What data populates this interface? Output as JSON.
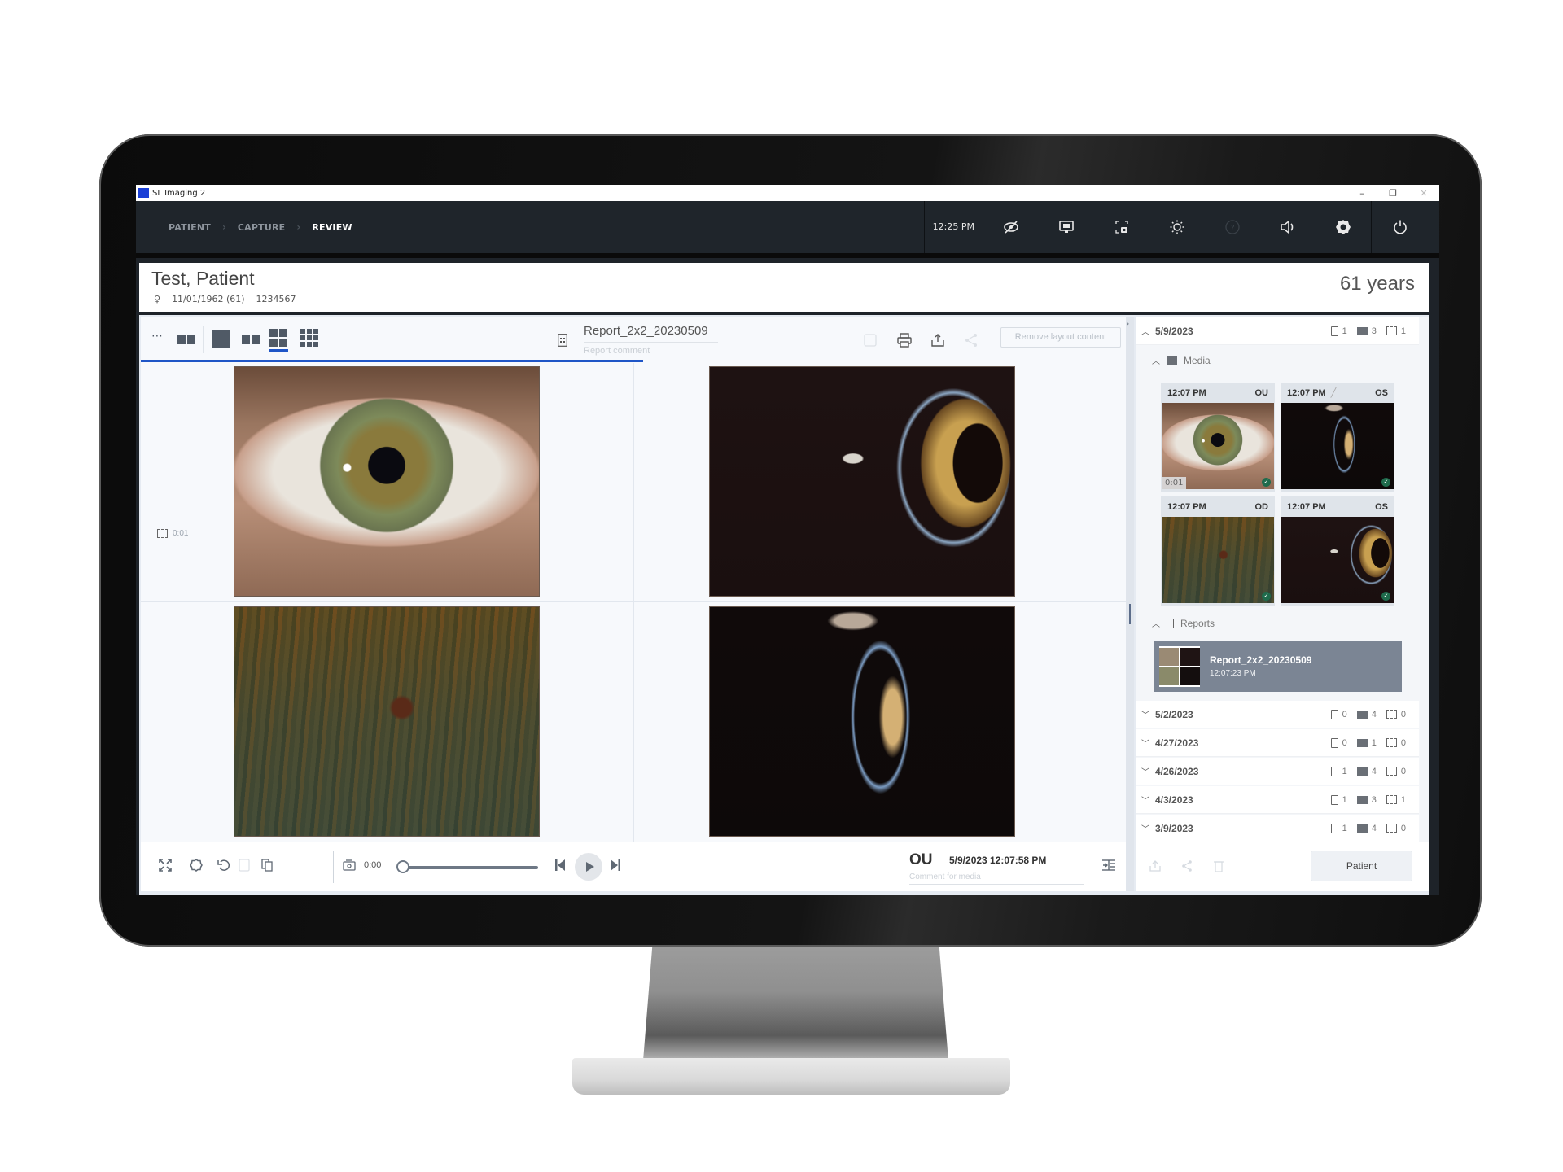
{
  "window": {
    "title": "SL Imaging 2",
    "minimize_label": "–",
    "maximize_label": "❐",
    "close_label": "✕"
  },
  "nav": {
    "breadcrumbs": [
      {
        "label": "PATIENT",
        "active": false
      },
      {
        "label": "CAPTURE",
        "active": false
      },
      {
        "label": "REVIEW",
        "active": true
      }
    ],
    "separator": "›",
    "time": "12:25 PM",
    "icons": [
      "eye-hidden-icon",
      "monitor-camera-icon",
      "screenshot-camera-icon",
      "brightness-icon",
      "help-icon",
      "volume-icon",
      "settings-gear-icon",
      "power-icon"
    ]
  },
  "patient": {
    "name": "Test, Patient",
    "sex_icon": "♀",
    "dob": "11/01/1962 (61)",
    "id": "1234567",
    "age": "61 years"
  },
  "toolbar": {
    "more_label": "⋯",
    "layouts": [
      "compare",
      "1x1",
      "1x2",
      "2x2",
      "3x3"
    ],
    "selected_layout": "2x2",
    "report_name": "Report_2x2_20230509",
    "report_comment_placeholder": "Report comment",
    "remove_layout_label": "Remove layout content",
    "progress_percent": 51
  },
  "viewer": {
    "cells": [
      {
        "position": "top-left",
        "eye": "OU",
        "kind": "video"
      },
      {
        "position": "top-right",
        "eye": "OS",
        "kind": "image"
      },
      {
        "position": "bottom-left",
        "eye": "OD",
        "kind": "image"
      },
      {
        "position": "bottom-right",
        "eye": "OS",
        "kind": "image"
      }
    ],
    "video_duration": "0:01"
  },
  "playback": {
    "current_time": "0:00",
    "position_fraction": 0.0,
    "media_eye": "OU",
    "media_datetime": "5/9/2023  12:07:58 PM",
    "media_comment_placeholder": "Comment for media"
  },
  "sidebar": {
    "expanded_visit": {
      "date": "5/9/2023",
      "reports": "1",
      "images": "3",
      "videos": "1",
      "media_label": "Media",
      "reports_label": "Reports",
      "thumbnails": [
        {
          "time": "12:07 PM",
          "eye": "OU",
          "duration": "0:01",
          "edited": false,
          "checked": true
        },
        {
          "time": "12:07 PM",
          "eye": "OS",
          "duration": "",
          "edited": true,
          "checked": true
        },
        {
          "time": "12:07 PM",
          "eye": "OD",
          "duration": "",
          "edited": false,
          "checked": true
        },
        {
          "time": "12:07 PM",
          "eye": "OS",
          "duration": "",
          "edited": false,
          "checked": true
        }
      ],
      "report": {
        "name": "Report_2x2_20230509",
        "time": "12:07:23 PM"
      }
    },
    "visits": [
      {
        "date": "5/2/2023",
        "reports": "0",
        "images": "4",
        "videos": "0"
      },
      {
        "date": "4/27/2023",
        "reports": "0",
        "images": "1",
        "videos": "0"
      },
      {
        "date": "4/26/2023",
        "reports": "1",
        "images": "4",
        "videos": "0"
      },
      {
        "date": "4/3/2023",
        "reports": "1",
        "images": "3",
        "videos": "1"
      },
      {
        "date": "3/9/2023",
        "reports": "1",
        "images": "4",
        "videos": "0"
      }
    ],
    "patient_button": "Patient"
  },
  "colors": {
    "accent": "#1f56c7",
    "nav_bg": "#1f252b",
    "selected_report_bg": "#7b8594",
    "check_green": "#1f6b4c"
  }
}
